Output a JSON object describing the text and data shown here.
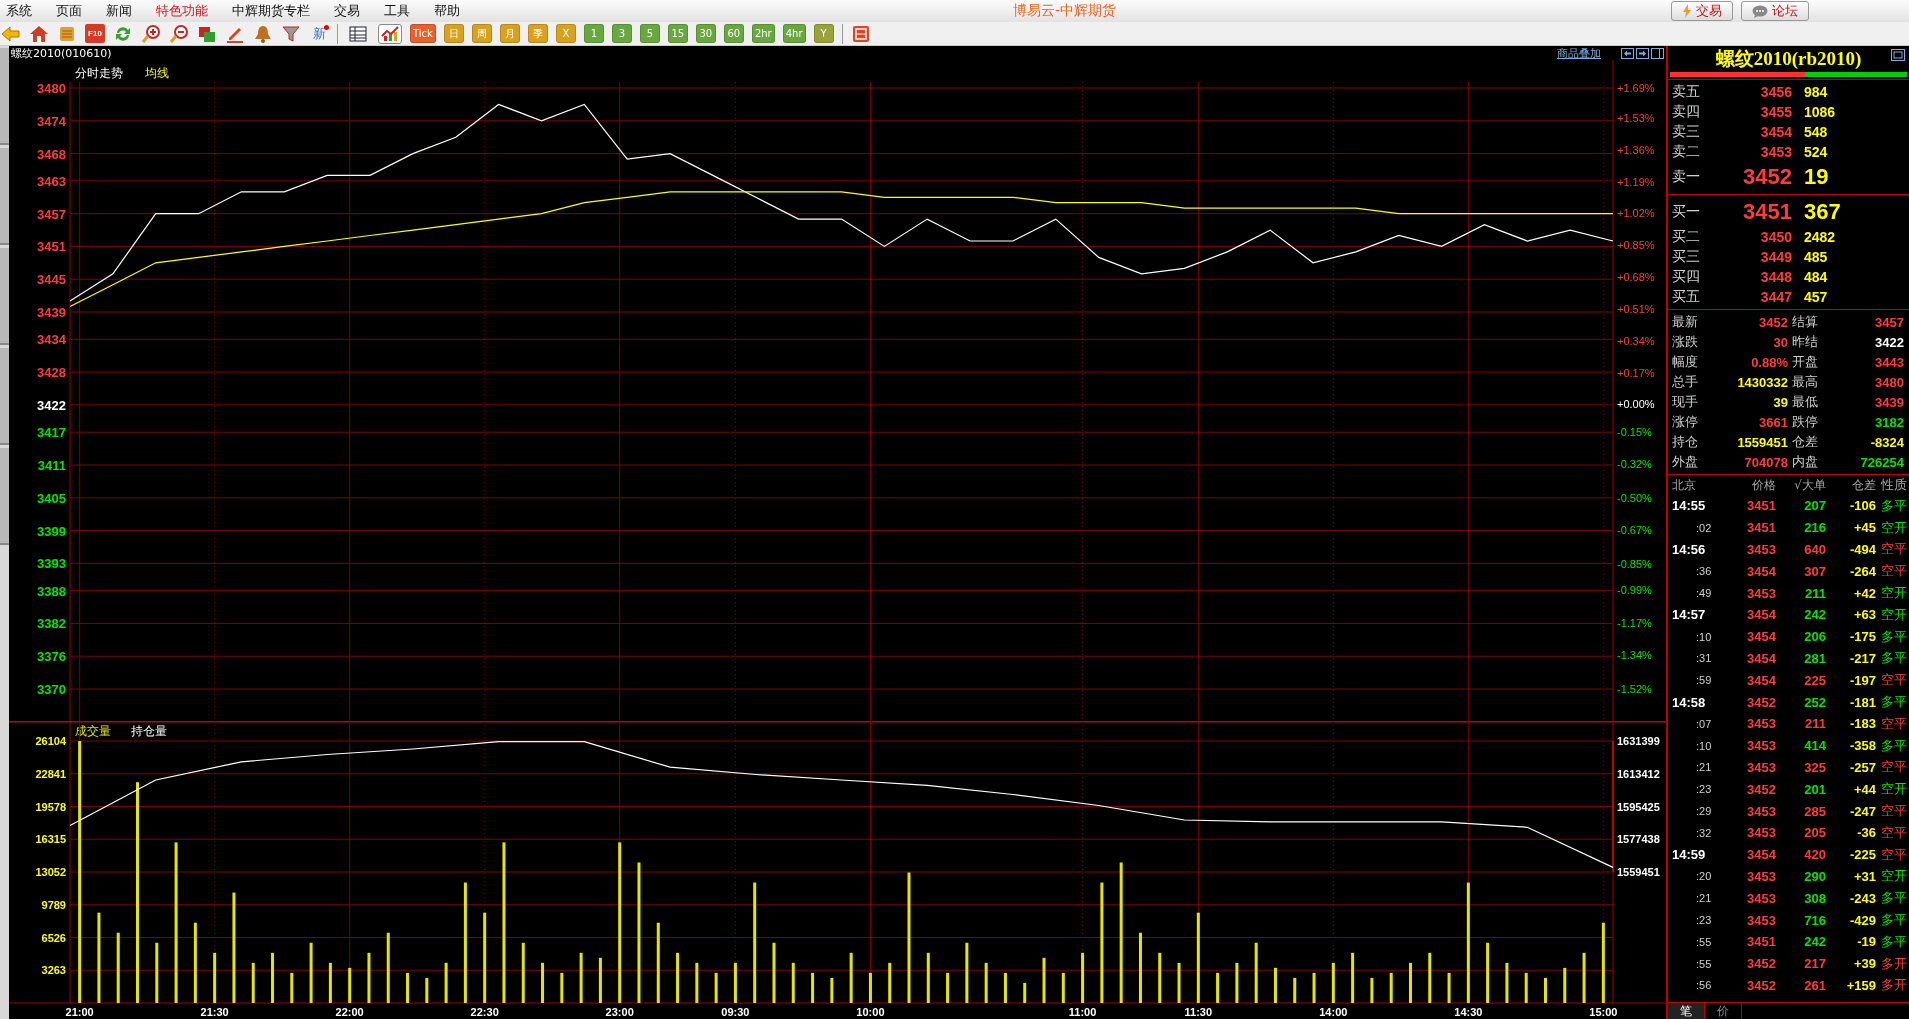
{
  "menu_bar": {
    "items": [
      {
        "label": "系统",
        "highlighted": false
      },
      {
        "label": "页面",
        "highlighted": false
      },
      {
        "label": "新闻",
        "highlighted": false
      },
      {
        "label": "特色功能",
        "highlighted": true
      },
      {
        "label": "中辉期货专栏",
        "highlighted": false
      },
      {
        "label": "交易",
        "highlighted": false
      },
      {
        "label": "工具",
        "highlighted": false
      },
      {
        "label": "帮助",
        "highlighted": false
      }
    ],
    "title": "博易云-中辉期货",
    "buttons": [
      {
        "label": "交易",
        "kind": "trade"
      },
      {
        "label": "论坛",
        "kind": "forum"
      }
    ]
  },
  "toolbar": {
    "f10_label": "F10",
    "news_label": "新",
    "view_buttons": [
      {
        "kind": "table",
        "selected": false
      },
      {
        "kind": "chart",
        "selected": true
      }
    ],
    "periods": [
      {
        "label": "Tick",
        "selected": false,
        "color": "#e8602c"
      },
      {
        "label": "日",
        "selected": false,
        "color": "#d9a11e"
      },
      {
        "label": "周",
        "selected": false,
        "color": "#d9a11e"
      },
      {
        "label": "月",
        "selected": false,
        "color": "#d9a11e"
      },
      {
        "label": "季",
        "selected": false,
        "color": "#d9a11e"
      },
      {
        "label": "X",
        "selected": false,
        "color": "#d9a11e"
      },
      {
        "label": "1",
        "selected": false,
        "color": "#69a83e"
      },
      {
        "label": "3",
        "selected": false,
        "color": "#69a83e"
      },
      {
        "label": "5",
        "selected": false,
        "color": "#69a83e"
      },
      {
        "label": "15",
        "selected": false,
        "color": "#69a83e"
      },
      {
        "label": "30",
        "selected": false,
        "color": "#69a83e"
      },
      {
        "label": "60",
        "selected": false,
        "color": "#69a83e"
      },
      {
        "label": "2hr",
        "selected": false,
        "color": "#69a83e"
      },
      {
        "label": "4hr",
        "selected": false,
        "color": "#69a83e"
      },
      {
        "label": "Y",
        "selected": false,
        "color": "#9aa23c"
      }
    ]
  },
  "chart_area": {
    "title": "螺纹2010(010610)",
    "overlay_link": "商品叠加",
    "price_pane": {
      "chart_data": {
        "type": "line",
        "grid": true,
        "ylim": [
          3370,
          3480
        ],
        "y2lim": [
          -1.52,
          1.69
        ],
        "yticks": [
          3480,
          3474,
          3468,
          3463,
          3457,
          3451,
          3445,
          3439,
          3434,
          3428,
          3422,
          3417,
          3411,
          3405,
          3399,
          3393,
          3388,
          3382,
          3376,
          3370
        ],
        "y2ticks": [
          {
            "value": 1.69,
            "label": "+1.69%"
          },
          {
            "value": 1.53,
            "label": "+1.53%"
          },
          {
            "value": 1.36,
            "label": "+1.36%"
          },
          {
            "value": 1.19,
            "label": "+1.19%"
          },
          {
            "value": 1.02,
            "label": "+1.02%"
          },
          {
            "value": 0.85,
            "label": "+0.85%"
          },
          {
            "value": 0.68,
            "label": "+0.68%"
          },
          {
            "value": 0.51,
            "label": "+0.51%"
          },
          {
            "value": 0.34,
            "label": "+0.34%"
          },
          {
            "value": 0.17,
            "label": "+0.17%"
          },
          {
            "value": 0,
            "label": "+0.00%"
          },
          {
            "value": -0.15,
            "label": "-0.15%"
          },
          {
            "value": -0.32,
            "label": "-0.32%"
          },
          {
            "value": -0.5,
            "label": "-0.50%"
          },
          {
            "value": -0.67,
            "label": "-0.67%"
          },
          {
            "value": -0.85,
            "label": "-0.85%"
          },
          {
            "value": -0.99,
            "label": "-0.99%"
          },
          {
            "value": -1.17,
            "label": "-1.17%"
          },
          {
            "value": -1.34,
            "label": "-1.34%"
          },
          {
            "value": -1.52,
            "label": "-1.52%"
          }
        ],
        "series": [
          {
            "name": "分时走势",
            "color": "#ffffff",
            "values": [
              3441,
              3446,
              3457,
              3457,
              3461,
              3461,
              3464,
              3464,
              3468,
              3471,
              3477,
              3474,
              3477,
              3467,
              3468,
              3464,
              3460,
              3456,
              3456,
              3451,
              3456,
              3452,
              3452,
              3456,
              3449,
              3446,
              3447,
              3450,
              3454,
              3448,
              3450,
              3453,
              3451,
              3455,
              3452,
              3454,
              3452
            ]
          },
          {
            "name": "均线",
            "color": "#ffff00",
            "values": [
              3440,
              3444,
              3448,
              3449,
              3450,
              3451,
              3452,
              3453,
              3454,
              3455,
              3456,
              3457,
              3459,
              3460,
              3461,
              3461,
              3461,
              3461,
              3461,
              3460,
              3460,
              3460,
              3460,
              3459,
              3459,
              3459,
              3458,
              3458,
              3458,
              3458,
              3458,
              3457,
              3457,
              3457,
              3457,
              3457,
              3457
            ]
          }
        ]
      }
    },
    "volume_pane": {
      "chart_data": {
        "type": "bar",
        "grid": true,
        "ylim": [
          0,
          26104
        ],
        "categories": [
          "21:00",
          null,
          null,
          null,
          null,
          null,
          null,
          "21:30",
          null,
          null,
          null,
          null,
          null,
          null,
          "22:00",
          null,
          null,
          null,
          null,
          null,
          null,
          "22:30",
          null,
          null,
          null,
          null,
          null,
          null,
          "23:00",
          null,
          null,
          null,
          null,
          null,
          "09:30",
          null,
          null,
          null,
          null,
          null,
          null,
          "10:00",
          null,
          null,
          null,
          null,
          null,
          null,
          null,
          null,
          null,
          null,
          "11:00",
          null,
          null,
          null,
          null,
          null,
          "11:30",
          null,
          null,
          null,
          null,
          null,
          null,
          "14:00",
          null,
          null,
          null,
          null,
          null,
          null,
          "14:30",
          null,
          null,
          null,
          null,
          null,
          null,
          "15:00"
        ],
        "yticks": [
          26104,
          22841,
          19578,
          16315,
          13052,
          9789,
          6526,
          3263
        ],
        "series": [
          {
            "name": "成交量",
            "color": "#e6e600",
            "values": [
              26100,
              9000,
              7000,
              22000,
              6000,
              16000,
              8000,
              5000,
              11000,
              4000,
              5000,
              3000,
              6000,
              4000,
              3500,
              5000,
              7000,
              3000,
              2500,
              4000,
              12000,
              9000,
              16000,
              6000,
              4000,
              3000,
              5000,
              4500,
              16000,
              14000,
              8000,
              5000,
              4000,
              3000,
              4000,
              12000,
              6000,
              4000,
              3000,
              2500,
              5000,
              3000,
              4000,
              13000,
              5000,
              3000,
              6000,
              4000,
              3000,
              2000,
              4500,
              3000,
              5000,
              12000,
              14000,
              7000,
              5000,
              4000,
              9000,
              3000,
              4000,
              6000,
              3500,
              2500,
              3000,
              4000,
              5000,
              2500,
              3000,
              4000,
              5000,
              3000,
              12000,
              6000,
              4000,
              3000,
              2500,
              3500,
              5000,
              8000
            ]
          }
        ]
      }
    },
    "open_interest": {
      "chart_data": {
        "type": "line",
        "ylim": [
          1559451,
          1631399
        ],
        "yticks": [
          1631399,
          1613412,
          1595425,
          1577438,
          1559451
        ],
        "series": [
          {
            "name": "持仓量",
            "color": "#ffffff",
            "values": [
              1585000,
              1610000,
              1620000,
              1624000,
              1627000,
              1631000,
              1631000,
              1617000,
              1613000,
              1610000,
              1607000,
              1602000,
              1596000,
              1588000,
              1587000,
              1587000,
              1587000,
              1584000,
              1562000
            ]
          }
        ]
      }
    }
  },
  "quote_panel": {
    "title": "螺纹2010(rb2010)",
    "ratio_bar": {
      "level": 0.57
    },
    "asks": [
      {
        "label": "卖五",
        "price": "3456",
        "volume": "984",
        "kind": "level"
      },
      {
        "label": "卖四",
        "price": "3455",
        "volume": "1086",
        "kind": "level"
      },
      {
        "label": "卖三",
        "price": "3454",
        "volume": "548",
        "kind": "level"
      },
      {
        "label": "卖二",
        "price": "3453",
        "volume": "524",
        "kind": "level"
      },
      {
        "label": "卖一",
        "price": "3452",
        "volume": "19",
        "kind": "best"
      }
    ],
    "bids": [
      {
        "label": "买一",
        "price": "3451",
        "volume": "367",
        "kind": "best"
      },
      {
        "label": "买二",
        "price": "3450",
        "volume": "2482",
        "kind": "level"
      },
      {
        "label": "买三",
        "price": "3449",
        "volume": "485",
        "kind": "level"
      },
      {
        "label": "买四",
        "price": "3448",
        "volume": "484",
        "kind": "level"
      },
      {
        "label": "买五",
        "price": "3447",
        "volume": "457",
        "kind": "level"
      }
    ],
    "stats": [
      {
        "label": "最新",
        "value": "3452",
        "color": "#ff3c3c"
      },
      {
        "label": "结算",
        "value": "3457",
        "color": "#ff3c3c"
      },
      {
        "label": "涨跌",
        "value": "30",
        "color": "#ff3c3c"
      },
      {
        "label": "昨结",
        "value": "3422",
        "color": "#ffffff"
      },
      {
        "label": "幅度",
        "value": "0.88%",
        "color": "#ff3c3c"
      },
      {
        "label": "开盘",
        "value": "3443",
        "color": "#ff3c3c"
      },
      {
        "label": "总手",
        "value": "1430332",
        "color": "#ffff00"
      },
      {
        "label": "最高",
        "value": "3480",
        "color": "#ff3c3c"
      },
      {
        "label": "现手",
        "value": "39",
        "color": "#ffff00"
      },
      {
        "label": "最低",
        "value": "3439",
        "color": "#ff3c3c"
      },
      {
        "label": "涨停",
        "value": "3661",
        "color": "#ff3c3c"
      },
      {
        "label": "跌停",
        "value": "3182",
        "color": "#00e600"
      },
      {
        "label": "持仓",
        "value": "1559451",
        "color": "#ffff00"
      },
      {
        "label": "仓差",
        "value": "-8324",
        "color": "#ffff00"
      },
      {
        "label": "外盘",
        "value": "704078",
        "color": "#ff3c3c"
      },
      {
        "label": "内盘",
        "value": "726254",
        "color": "#00e600"
      }
    ],
    "trade_columns": [
      "北京",
      "价格",
      "√大单",
      "仓差",
      "性质"
    ],
    "trades": [
      {
        "time": "14:55",
        "kind": "minute",
        "price": "3451",
        "volume": "207",
        "diff": "-106",
        "nature": "多平",
        "color": "#00e600"
      },
      {
        "time": ":02",
        "kind": "second",
        "price": "3451",
        "volume": "216",
        "diff": "+45",
        "nature": "空开",
        "color": "#00e600"
      },
      {
        "time": "14:56",
        "kind": "minute",
        "price": "3453",
        "volume": "640",
        "diff": "-494",
        "nature": "空平",
        "color": "#ff3c3c"
      },
      {
        "time": ":36",
        "kind": "second",
        "price": "3454",
        "volume": "307",
        "diff": "-264",
        "nature": "空平",
        "color": "#ff3c3c"
      },
      {
        "time": ":49",
        "kind": "second",
        "price": "3453",
        "volume": "211",
        "diff": "+42",
        "nature": "空开",
        "color": "#00e600"
      },
      {
        "time": "14:57",
        "kind": "minute",
        "price": "3454",
        "volume": "242",
        "diff": "+63",
        "nature": "空开",
        "color": "#00e600"
      },
      {
        "time": ":10",
        "kind": "second",
        "price": "3454",
        "volume": "206",
        "diff": "-175",
        "nature": "多平",
        "color": "#00e600"
      },
      {
        "time": ":31",
        "kind": "second",
        "price": "3454",
        "volume": "281",
        "diff": "-217",
        "nature": "多平",
        "color": "#00e600"
      },
      {
        "time": ":59",
        "kind": "second",
        "price": "3454",
        "volume": "225",
        "diff": "-197",
        "nature": "空平",
        "color": "#ff3c3c"
      },
      {
        "time": "14:58",
        "kind": "minute",
        "price": "3452",
        "volume": "252",
        "diff": "-181",
        "nature": "多平",
        "color": "#00e600"
      },
      {
        "time": ":07",
        "kind": "second",
        "price": "3453",
        "volume": "211",
        "diff": "-183",
        "nature": "空平",
        "color": "#ff3c3c"
      },
      {
        "time": ":10",
        "kind": "second",
        "price": "3453",
        "volume": "414",
        "diff": "-358",
        "nature": "多平",
        "color": "#00e600"
      },
      {
        "time": ":21",
        "kind": "second",
        "price": "3453",
        "volume": "325",
        "diff": "-257",
        "nature": "空平",
        "color": "#ff3c3c"
      },
      {
        "time": ":23",
        "kind": "second",
        "price": "3452",
        "volume": "201",
        "diff": "+44",
        "nature": "空开",
        "color": "#00e600"
      },
      {
        "time": ":29",
        "kind": "second",
        "price": "3453",
        "volume": "285",
        "diff": "-247",
        "nature": "空平",
        "color": "#ff3c3c"
      },
      {
        "time": ":32",
        "kind": "second",
        "price": "3453",
        "volume": "205",
        "diff": "-36",
        "nature": "空平",
        "color": "#ff3c3c"
      },
      {
        "time": "14:59",
        "kind": "minute",
        "price": "3454",
        "volume": "420",
        "diff": "-225",
        "nature": "空平",
        "color": "#ff3c3c"
      },
      {
        "time": ":20",
        "kind": "second",
        "price": "3453",
        "volume": "290",
        "diff": "+31",
        "nature": "空开",
        "color": "#00e600"
      },
      {
        "time": ":21",
        "kind": "second",
        "price": "3453",
        "volume": "308",
        "diff": "-243",
        "nature": "多平",
        "color": "#00e600"
      },
      {
        "time": ":23",
        "kind": "second",
        "price": "3453",
        "volume": "716",
        "diff": "-429",
        "nature": "多平",
        "color": "#00e600"
      },
      {
        "time": ":55",
        "kind": "second",
        "price": "3451",
        "volume": "242",
        "diff": "-19",
        "nature": "多平",
        "color": "#00e600"
      },
      {
        "time": ":55",
        "kind": "second",
        "price": "3452",
        "volume": "217",
        "diff": "+39",
        "nature": "多开",
        "color": "#ff3c3c"
      },
      {
        "time": ":56",
        "kind": "second",
        "price": "3452",
        "volume": "261",
        "diff": "+159",
        "nature": "多开",
        "color": "#ff3c3c"
      }
    ],
    "tabs": [
      {
        "label": "笔",
        "selected": true
      },
      {
        "label": "价",
        "selected": false
      }
    ]
  }
}
